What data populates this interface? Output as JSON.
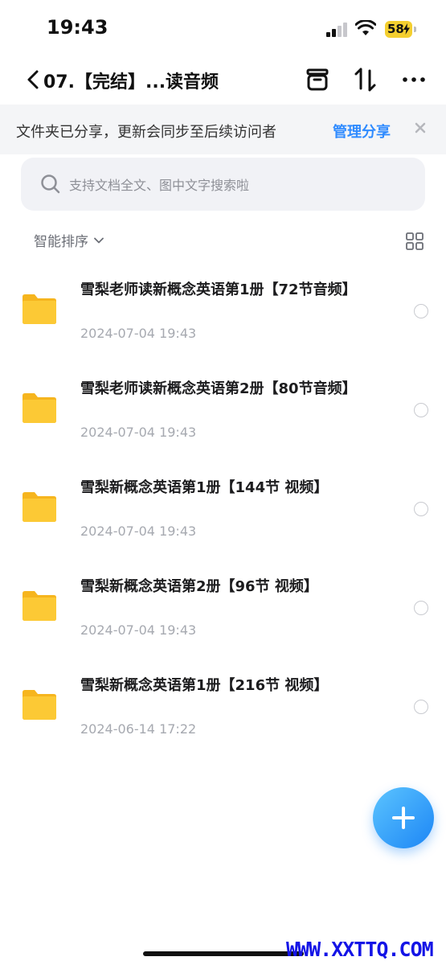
{
  "status_bar": {
    "time": "19:43",
    "battery": "58"
  },
  "nav": {
    "title": "07.【完结】...读音频"
  },
  "share_banner": {
    "text": "文件夹已分享，更新会同步至后续访问者",
    "manage_label": "管理分享"
  },
  "search": {
    "placeholder": "支持文档全文、图中文字搜索啦"
  },
  "sort": {
    "label": "智能排序"
  },
  "files": [
    {
      "name": "雪梨老师读新概念英语第1册【72节音频】",
      "date": "2024-07-04 19:43"
    },
    {
      "name": "雪梨老师读新概念英语第2册【80节音频】",
      "date": "2024-07-04 19:43"
    },
    {
      "name": "雪梨新概念英语第1册【144节 视频】",
      "date": "2024-07-04 19:43"
    },
    {
      "name": "雪梨新概念英语第2册【96节 视频】",
      "date": "2024-07-04 19:43"
    },
    {
      "name": "雪梨新概念英语第1册【216节 视频】",
      "date": "2024-06-14 17:22"
    }
  ],
  "watermark": "WWW.XXTTQ.COM",
  "colors": {
    "accent": "#2f8bff",
    "folder": "#fcc935",
    "battery": "#f4cf2f"
  }
}
